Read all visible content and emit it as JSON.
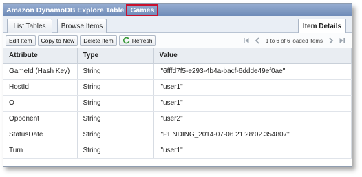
{
  "window": {
    "title": "Amazon DynamoDB Explore Table",
    "table_name": "Games"
  },
  "tabs": {
    "list_tables": "List Tables",
    "browse_items": "Browse Items",
    "item_details": "Item Details"
  },
  "toolbar": {
    "edit_item": "Edit Item",
    "copy_to_new": "Copy to New",
    "delete_item": "Delete Item",
    "refresh": "Refresh",
    "pager_text": "1 to 6 of 6 loaded items"
  },
  "grid": {
    "headers": [
      "Attribute",
      "Type",
      "Value"
    ],
    "rows": [
      {
        "attribute": "GameId (Hash Key)",
        "type": "String",
        "value": "\"6fffd7f5-e293-4b4a-bacf-6ddde49ef0ae\""
      },
      {
        "attribute": "HostId",
        "type": "String",
        "value": "\"user1\""
      },
      {
        "attribute": "O",
        "type": "String",
        "value": "\"user1\""
      },
      {
        "attribute": "Opponent",
        "type": "String",
        "value": "\"user2\""
      },
      {
        "attribute": "StatusDate",
        "type": "String",
        "value": "\"PENDING_2014-07-06 21:28:02.354807\""
      },
      {
        "attribute": "Turn",
        "type": "String",
        "value": "\"user1\""
      }
    ]
  },
  "colors": {
    "titlebar": "#7a94c0",
    "highlight_box": "#c8102e",
    "refresh_icon": "#3a9a3a"
  },
  "icons": {
    "refresh": "refresh-icon",
    "first_page": "first-page-icon",
    "prev_page": "prev-page-icon",
    "next_page": "next-page-icon",
    "last_page": "last-page-icon"
  }
}
